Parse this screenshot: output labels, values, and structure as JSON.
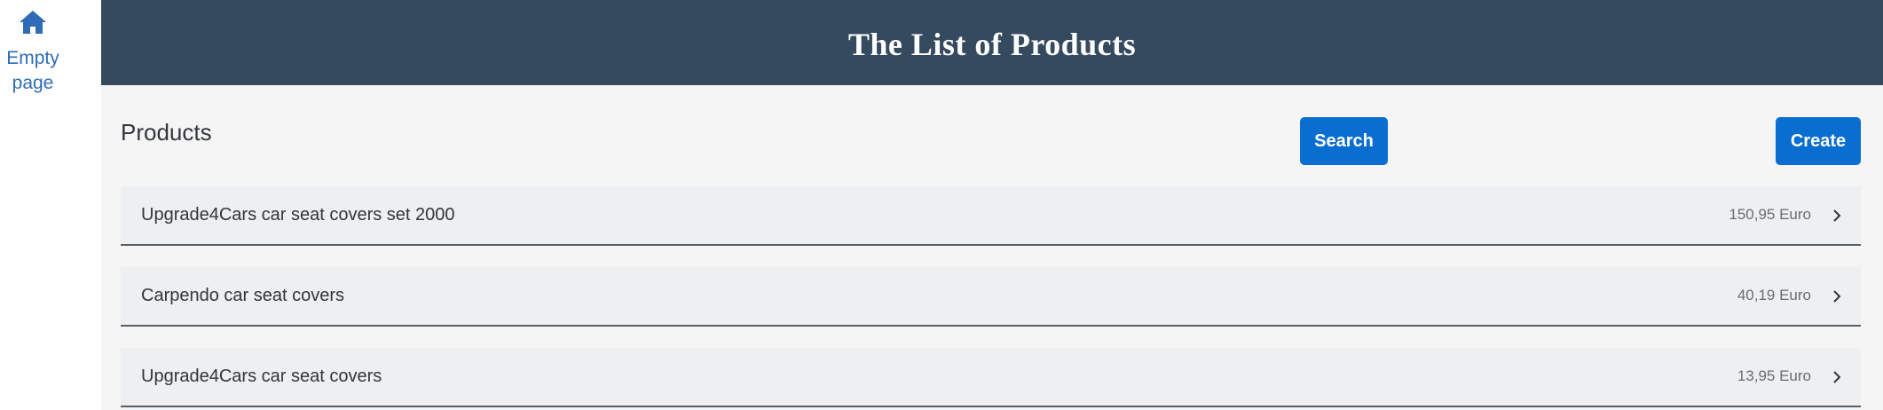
{
  "nav": {
    "home_icon": "home-icon",
    "label": "Empty page"
  },
  "header": {
    "title": "The List of Products"
  },
  "page": {
    "title": "Products",
    "search_label": "Search",
    "create_label": "Create"
  },
  "products": [
    {
      "name": "Upgrade4Cars car seat covers set 2000",
      "price": "150,95 Euro"
    },
    {
      "name": "Carpendo car seat covers",
      "price": "40,19 Euro"
    },
    {
      "name": "Upgrade4Cars car seat covers",
      "price": "13,95 Euro"
    }
  ],
  "colors": {
    "header_bg": "#354a5f",
    "accent": "#0a6ed1",
    "nav_link": "#2e6db6"
  }
}
